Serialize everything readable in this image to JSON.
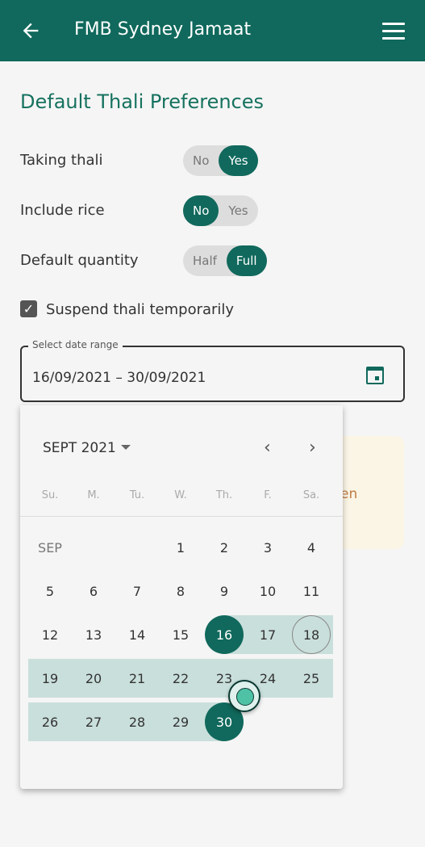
{
  "appbar": {
    "title": "FMB Sydney Jamaat",
    "back_icon": "arrow-left-icon",
    "menu_icon": "hamburger-menu-icon"
  },
  "page_title": "Default Thali Preferences",
  "prefs": [
    {
      "label": "Taking thali",
      "options": [
        "No",
        "Yes"
      ],
      "selected": "Yes"
    },
    {
      "label": "Include rice",
      "options": [
        "No",
        "Yes"
      ],
      "selected": "No"
    },
    {
      "label": "Default quantity",
      "options": [
        "Half",
        "Full"
      ],
      "selected": "Full"
    }
  ],
  "suspend": {
    "label": "Suspend thali temporarily",
    "checked": true
  },
  "date_range": {
    "label": "Select date range",
    "value": "16/09/2021 – 30/09/2021",
    "icon": "calendar-icon"
  },
  "card_text": "en",
  "calendar": {
    "month_label": "SEPT 2021",
    "prev": "‹",
    "next": "›",
    "weekdays": [
      "Su.",
      "M.",
      "Tu.",
      "W.",
      "Th.",
      "F.",
      "Sa."
    ],
    "month_short": "SEP",
    "weeks": [
      [
        null,
        null,
        null,
        1,
        2,
        3,
        4
      ],
      [
        5,
        6,
        7,
        8,
        9,
        10,
        11
      ],
      [
        12,
        13,
        14,
        15,
        16,
        17,
        18
      ],
      [
        19,
        20,
        21,
        22,
        23,
        24,
        25
      ],
      [
        26,
        27,
        28,
        29,
        30,
        null,
        null
      ]
    ],
    "range_start": 16,
    "range_end": 30,
    "today": 18
  },
  "colors": {
    "primary": "#10695c",
    "range": "#c9dfdb",
    "warning_text": "#c07b44"
  }
}
